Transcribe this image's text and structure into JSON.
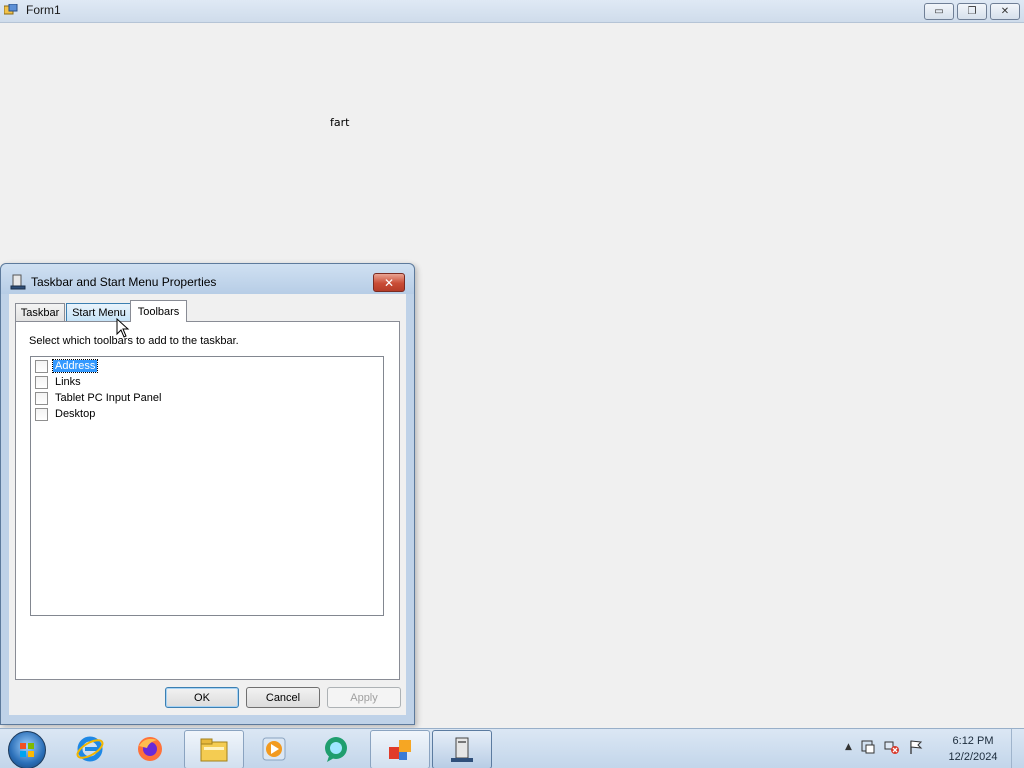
{
  "form1": {
    "title": "Form1",
    "label": "fart",
    "caption_buttons": {
      "minimize": "▭",
      "restore": "❐",
      "close": "✕"
    }
  },
  "dialog": {
    "title": "Taskbar and Start Menu Properties",
    "close_label": "✕",
    "tabs": [
      {
        "label": "Taskbar"
      },
      {
        "label": "Start Menu"
      },
      {
        "label": "Toolbars"
      }
    ],
    "active_tab": "Toolbars",
    "instruction": "Select which toolbars to add to the taskbar.",
    "toolbars": [
      {
        "label": "Address",
        "checked": false,
        "selected": true
      },
      {
        "label": "Links",
        "checked": false,
        "selected": false
      },
      {
        "label": "Tablet PC Input Panel",
        "checked": false,
        "selected": false
      },
      {
        "label": "Desktop",
        "checked": false,
        "selected": false
      }
    ],
    "buttons": {
      "ok": "OK",
      "cancel": "Cancel",
      "apply": "Apply"
    }
  },
  "taskbar": {
    "items": [
      {
        "name": "internet-explorer-icon"
      },
      {
        "name": "firefox-icon"
      },
      {
        "name": "file-explorer-icon"
      },
      {
        "name": "media-player-icon"
      },
      {
        "name": "chat-app-icon"
      },
      {
        "name": "office-app-icon"
      },
      {
        "name": "server-app-icon"
      }
    ],
    "clock_time": "6:12 PM",
    "clock_date": "12/2/2024"
  }
}
